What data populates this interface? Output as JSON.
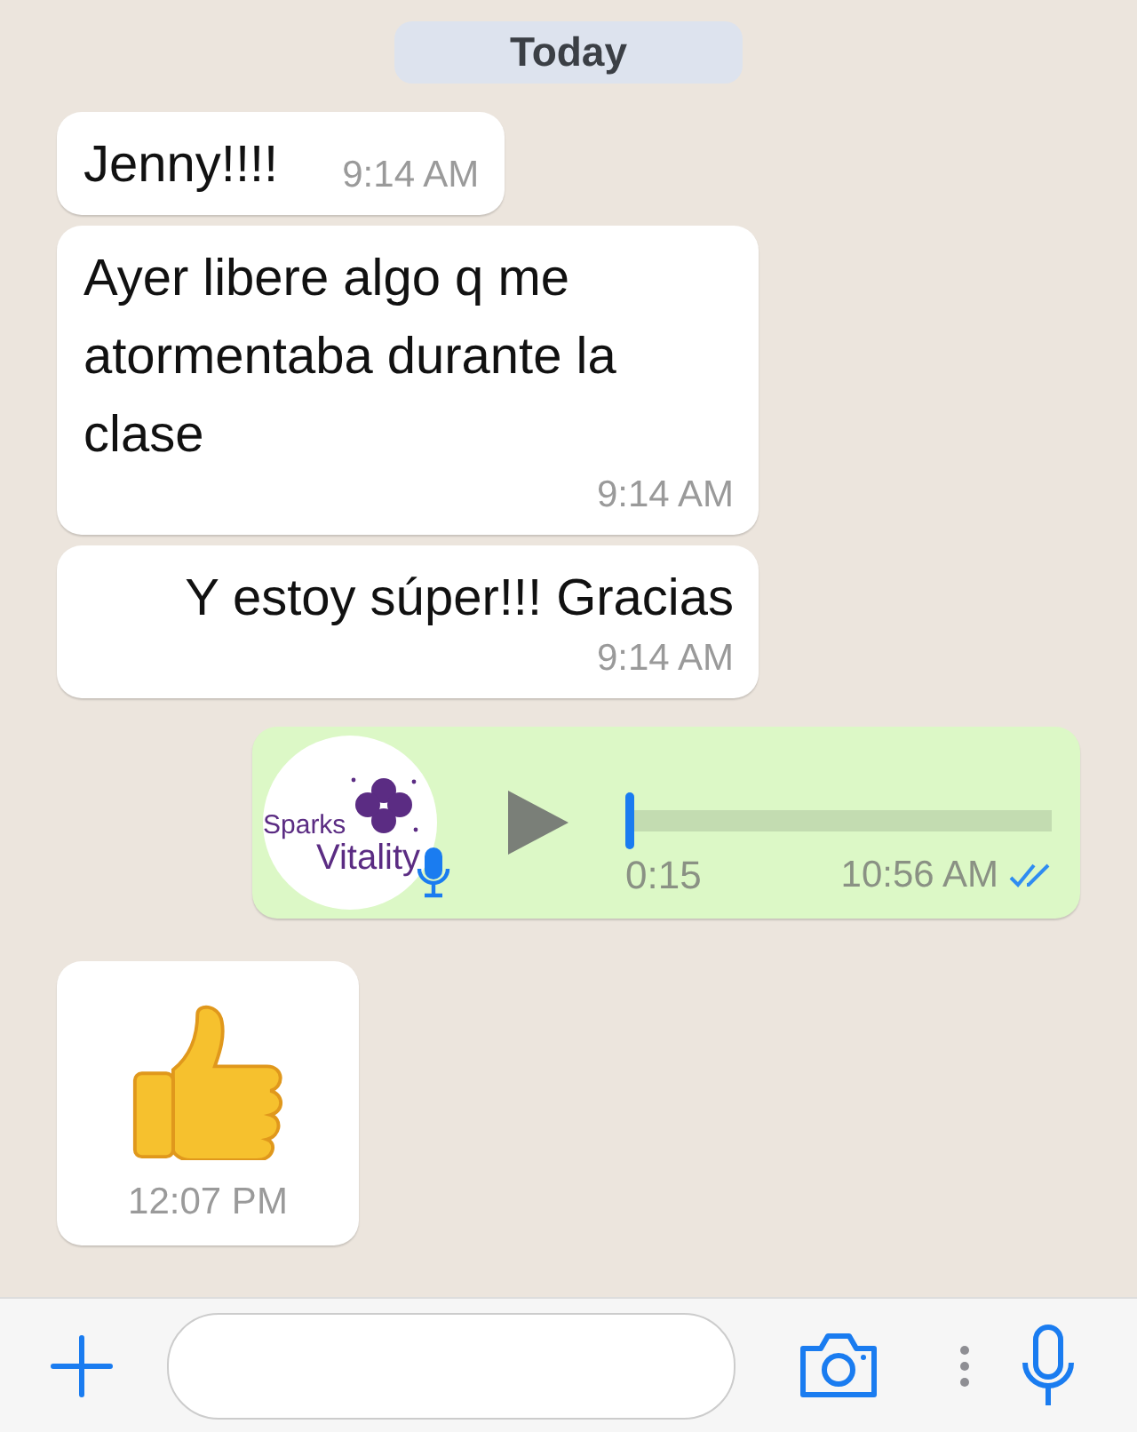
{
  "date_label": "Today",
  "messages": [
    {
      "kind": "text",
      "outgoing": false,
      "text": "Jenny!!!!",
      "time": "9:14 AM"
    },
    {
      "kind": "text",
      "outgoing": false,
      "text": "Ayer libere algo q me atormentaba durante la clase",
      "time": "9:14 AM"
    },
    {
      "kind": "text",
      "outgoing": false,
      "text": "Y estoy súper!!! Gracias",
      "time": "9:14 AM"
    },
    {
      "kind": "voice",
      "outgoing": true,
      "avatar_logo": [
        "Sparks",
        "Vitality"
      ],
      "level": 0.0,
      "duration": "0:15",
      "time": "10:56 AM",
      "read": true
    },
    {
      "kind": "emoji",
      "outgoing": false,
      "time": "12:07 PM"
    }
  ]
}
